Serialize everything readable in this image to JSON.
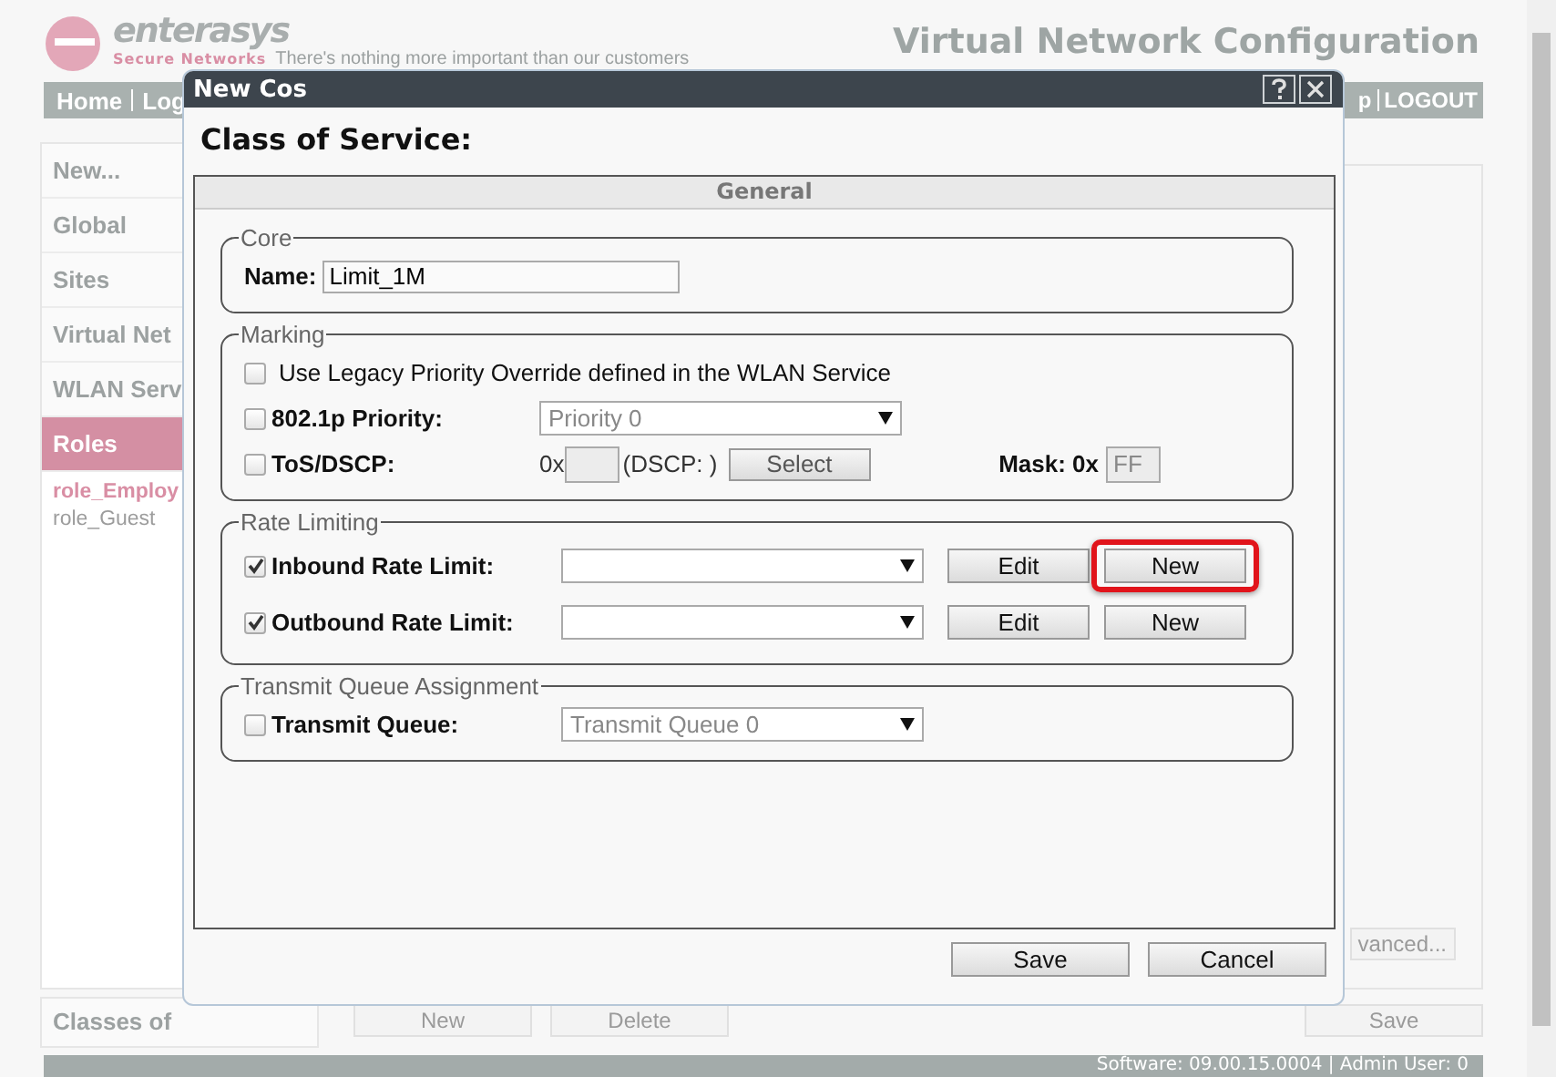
{
  "header": {
    "brand": "enterasys",
    "brand_sub": "Secure Networks",
    "tagline": "There's nothing more important than our customers",
    "title": "Virtual Network Configuration"
  },
  "nav": {
    "left": [
      "Home",
      "Log"
    ],
    "right": [
      "p",
      "LOGOUT"
    ]
  },
  "sidebar": {
    "items": [
      {
        "label": "New...",
        "selected": false
      },
      {
        "label": "Global",
        "selected": false
      },
      {
        "label": "Sites",
        "selected": false
      },
      {
        "label": "Virtual Net",
        "selected": false
      },
      {
        "label": "WLAN Serv",
        "selected": false
      },
      {
        "label": "Roles",
        "selected": true
      }
    ],
    "subitems": [
      {
        "label": "role_Employ",
        "selected": true
      },
      {
        "label": "role_Guest",
        "selected": false
      }
    ],
    "footer": "Classes of"
  },
  "background_buttons": {
    "advanced": "vanced...",
    "left": [
      "New",
      "Delete"
    ],
    "save": "Save"
  },
  "status_bar": "Software: 09.00.15.0004 | Admin User: 0",
  "dialog": {
    "title": "New Cos",
    "heading": "Class of Service:",
    "tab": "General",
    "sections": [
      {
        "legend": "Core",
        "rows": [
          {
            "kind": "text",
            "label": "Name:",
            "value": "Limit_1M"
          }
        ]
      },
      {
        "legend": "Marking",
        "rows": [
          {
            "kind": "check",
            "label": "Use Legacy Priority Override defined in the WLAN Service",
            "checked": false
          },
          {
            "kind": "select",
            "label": "802.1p Priority:",
            "checked": false,
            "value": "Priority 0"
          },
          {
            "kind": "tos",
            "label": "ToS/DSCP:",
            "checked": false,
            "prefix": "0x",
            "dscp": "(DSCP: )",
            "button": "Select",
            "mask_label": "Mask: 0x",
            "mask": "FF"
          }
        ]
      },
      {
        "legend": "Rate Limiting",
        "rows": [
          {
            "kind": "rate",
            "label": "Inbound Rate Limit:",
            "checked": true,
            "buttons": [
              {
                "label": "Edit",
                "highlighted": false
              },
              {
                "label": "New",
                "highlighted": true
              }
            ]
          },
          {
            "kind": "rate",
            "label": "Outbound Rate Limit:",
            "checked": true,
            "buttons": [
              {
                "label": "Edit",
                "highlighted": false
              },
              {
                "label": "New",
                "highlighted": false
              }
            ]
          }
        ]
      },
      {
        "legend": "Transmit Queue Assignment",
        "rows": [
          {
            "kind": "select",
            "label": "Transmit Queue:",
            "checked": false,
            "value": "Transmit Queue 0"
          }
        ]
      }
    ],
    "buttons": [
      "Save",
      "Cancel"
    ]
  }
}
